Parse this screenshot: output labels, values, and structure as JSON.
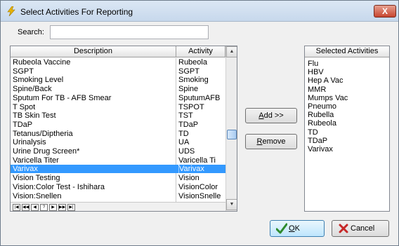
{
  "window": {
    "title": "Select Activities For Reporting",
    "close_label": "X"
  },
  "search": {
    "label": "Search:",
    "value": ""
  },
  "grid": {
    "headers": {
      "description": "Description",
      "activity": "Activity"
    },
    "rows": [
      {
        "description": "Rubeola Vaccine",
        "activity": "Rubeola"
      },
      {
        "description": "SGPT",
        "activity": "SGPT"
      },
      {
        "description": "Smoking Level",
        "activity": "Smoking"
      },
      {
        "description": "Spine/Back",
        "activity": "Spine"
      },
      {
        "description": "Sputum For TB - AFB Smear",
        "activity": "SputumAFB"
      },
      {
        "description": "T Spot",
        "activity": "TSPOT"
      },
      {
        "description": "TB Skin Test",
        "activity": "TST"
      },
      {
        "description": "TDaP",
        "activity": "TDaP"
      },
      {
        "description": "Tetanus/Diptheria",
        "activity": "TD"
      },
      {
        "description": "Urinalysis",
        "activity": "UA"
      },
      {
        "description": "Urine Drug Screen*",
        "activity": "UDS"
      },
      {
        "description": "Varicella Titer",
        "activity": "Varicella Ti"
      },
      {
        "description": "Varivax",
        "activity": "Varivax"
      },
      {
        "description": "Vision Testing",
        "activity": "Vision"
      },
      {
        "description": "Vision:Color Test - Ishihara",
        "activity": "VisionColor"
      },
      {
        "description": "Vision:Snellen",
        "activity": "VisionSnelle"
      }
    ],
    "selected_index": 12,
    "scroll_position_fraction": 0.55,
    "nav_buttons": [
      {
        "name": "first-record-button",
        "glyph": "|◀"
      },
      {
        "name": "prev-page-button",
        "glyph": "◀◀"
      },
      {
        "name": "prev-record-button",
        "glyph": "◀"
      },
      {
        "name": "help-button",
        "glyph": "?"
      },
      {
        "name": "next-record-button",
        "glyph": "▶"
      },
      {
        "name": "next-page-button",
        "glyph": "▶▶"
      },
      {
        "name": "last-record-button",
        "glyph": "▶|"
      }
    ]
  },
  "actions": {
    "add_prefix": "A",
    "add_rest": "dd >>",
    "remove_prefix": "R",
    "remove_rest": "emove"
  },
  "selected_activities": {
    "header": "Selected Activities",
    "items": [
      "Flu",
      "HBV",
      "Hep A Vac",
      "MMR",
      "Mumps Vac",
      "Pneumo",
      "Rubella",
      "Rubeola",
      "TD",
      "TDaP",
      "Varivax"
    ]
  },
  "footer": {
    "ok_prefix": "O",
    "ok_rest": "K",
    "cancel_label": "Cancel"
  },
  "colors": {
    "selection": "#3399ff",
    "ok_check": "#2e8b2e",
    "cancel_x": "#c62828",
    "title_icon": "#e8b400"
  }
}
